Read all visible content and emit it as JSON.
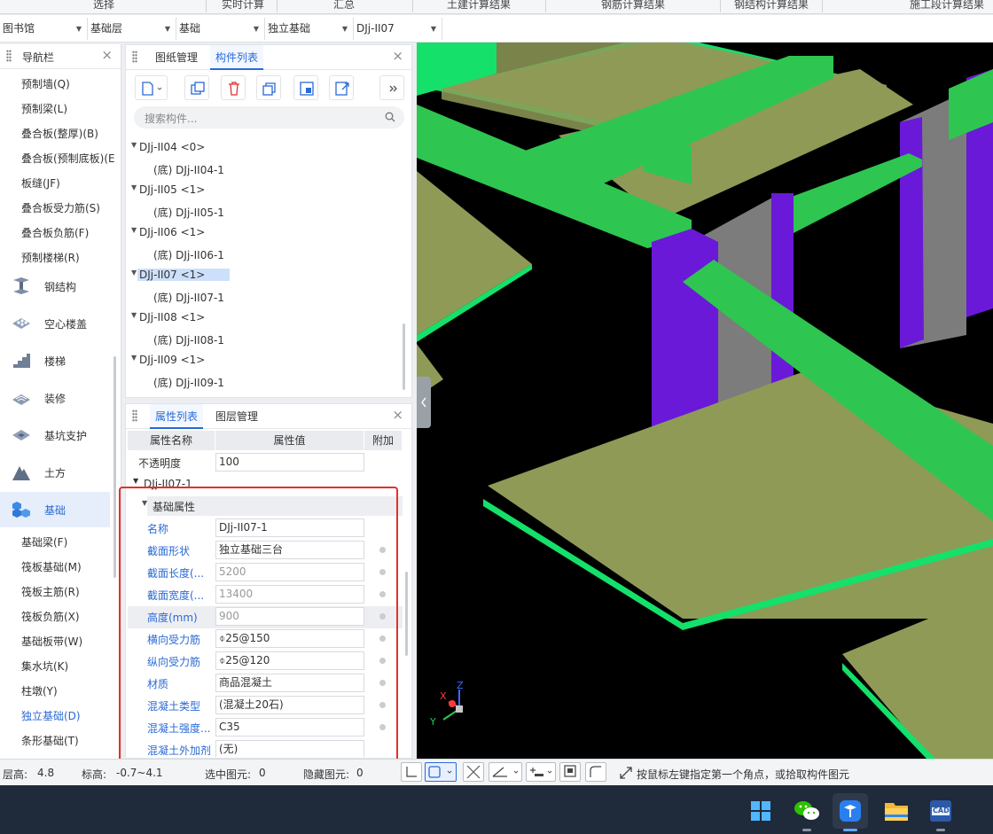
{
  "ribbon": {
    "items": [
      "选择",
      "实时计算",
      "汇总",
      "土建计算结果",
      "钢筋计算结果",
      "钢结构计算结果",
      "施工段计算结果"
    ]
  },
  "selectors": [
    {
      "value": "图书馆"
    },
    {
      "value": "基础层"
    },
    {
      "value": "基础"
    },
    {
      "value": "独立基础"
    },
    {
      "value": "DJj-II07"
    }
  ],
  "nav": {
    "title": "导航栏",
    "top_items": [
      "预制墙(Q)",
      "预制梁(L)",
      "叠合板(整厚)(B)",
      "叠合板(预制底板)(E",
      "板缝(JF)",
      "叠合板受力筋(S)",
      "叠合板负筋(F)",
      "预制楼梯(R)"
    ],
    "categories": [
      {
        "label": "钢结构",
        "icon": "steel-beam-icon"
      },
      {
        "label": "空心楼盖",
        "icon": "hollow-slab-icon"
      },
      {
        "label": "楼梯",
        "icon": "stairs-icon"
      },
      {
        "label": "装修",
        "icon": "decoration-icon"
      },
      {
        "label": "基坑支护",
        "icon": "pit-support-icon"
      },
      {
        "label": "土方",
        "icon": "earthwork-icon"
      },
      {
        "label": "基础",
        "icon": "foundation-cubes-icon"
      }
    ],
    "active_category": "基础",
    "sub_items": [
      "基础梁(F)",
      "筏板基础(M)",
      "筏板主筋(R)",
      "筏板负筋(X)",
      "基础板带(W)",
      "集水坑(K)",
      "柱墩(Y)",
      "独立基础(D)",
      "条形基础(T)"
    ],
    "active_sub_item": "独立基础(D)"
  },
  "component_panel": {
    "tabs": [
      "图纸管理",
      "构件列表"
    ],
    "active_tab": "构件列表",
    "toolbar_icons": [
      "new-component-icon",
      "copy-icon",
      "delete-icon",
      "layer-copy-icon",
      "extract-icon",
      "filter-icon",
      "more-icon"
    ],
    "search_placeholder": "搜索构件...",
    "tree": [
      {
        "label": "DJj-II04  <0>",
        "child": "(底) DJj-II04-1"
      },
      {
        "label": "DJj-II05  <1>",
        "child": "(底) DJj-II05-1"
      },
      {
        "label": "DJj-II06  <1>",
        "child": "(底) DJj-II06-1"
      },
      {
        "label": "DJj-II07  <1>",
        "child": "(底) DJj-II07-1"
      },
      {
        "label": "DJj-II08  <1>",
        "child": "(底) DJj-II08-1"
      },
      {
        "label": "DJj-II09  <1>",
        "child": "(底) DJj-II09-1"
      }
    ],
    "selected": "DJj-II07  <1>"
  },
  "property_panel": {
    "tabs": [
      "属性列表",
      "图层管理"
    ],
    "active_tab": "属性列表",
    "headers": [
      "属性名称",
      "属性值",
      "附加"
    ],
    "opacity": {
      "name": "不透明度",
      "value": "100"
    },
    "group": "DJj-II07-1",
    "section": "基础属性",
    "rows": [
      {
        "name": "名称",
        "value": "DJj-II07-1",
        "gray": false,
        "dot": false
      },
      {
        "name": "截面形状",
        "value": "独立基础三台",
        "gray": false,
        "dot": true
      },
      {
        "name": "截面长度(...",
        "value": "5200",
        "gray": true,
        "dot": true
      },
      {
        "name": "截面宽度(...",
        "value": "13400",
        "gray": true,
        "dot": true
      },
      {
        "name": "高度(mm)",
        "value": "900",
        "gray": true,
        "dot": true
      },
      {
        "name": "横向受力筋",
        "value": "⌽25@150",
        "gray": false,
        "dot": true
      },
      {
        "name": "纵向受力筋",
        "value": "⌽25@120",
        "gray": false,
        "dot": true
      },
      {
        "name": "材质",
        "value": "商品混凝土",
        "gray": false,
        "dot": true
      },
      {
        "name": "混凝土类型",
        "value": "(混凝土20石)",
        "gray": false,
        "dot": true
      },
      {
        "name": "混凝土强度...",
        "value": "C35",
        "gray": false,
        "dot": true
      },
      {
        "name": "混凝土外加剂",
        "value": "(无)",
        "gray": false,
        "dot": false
      }
    ]
  },
  "axes": {
    "x": "X",
    "y": "Y",
    "z": "Z"
  },
  "status": {
    "floor_height_label": "层高:",
    "floor_height": "4.8",
    "elevation_label": "标高:",
    "elevation": "-0.7~4.1",
    "selected_label": "选中图元:",
    "selected": "0",
    "hidden_label": "隐藏图元:",
    "hidden": "0",
    "hint": "按鼠标左键指定第一个角点，或拾取构件图元"
  },
  "colors": {
    "accent": "#2a6ad6",
    "highlight_box": "#e0322b",
    "slab": "#8f9a57",
    "beam": "#2ec650",
    "column": "#6a19d8",
    "wall": "#7c7c7c"
  },
  "taskbar": {
    "apps": [
      "windows-start-icon",
      "wechat-icon",
      "app-active-icon",
      "file-explorer-icon",
      "cad-icon"
    ],
    "cad_label": "CAD"
  }
}
